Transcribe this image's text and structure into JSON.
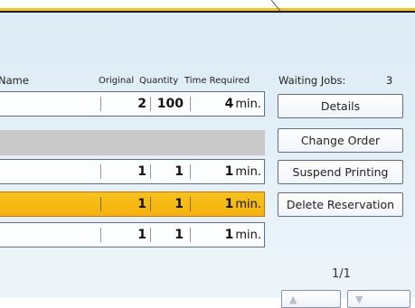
{
  "header": {
    "name": "Name",
    "original": "Original",
    "quantity": "Quantity",
    "time_required": "Time Required",
    "waiting_jobs_label": "Waiting Jobs:",
    "waiting_jobs_count": "3"
  },
  "jobs": [
    {
      "original": "2",
      "quantity": "100",
      "time": "4",
      "unit": "min.",
      "state": "normal"
    },
    {
      "original": "",
      "quantity": "",
      "time": "",
      "unit": "",
      "state": "empty"
    },
    {
      "original": "1",
      "quantity": "1",
      "time": "1",
      "unit": "min.",
      "state": "normal"
    },
    {
      "original": "1",
      "quantity": "1",
      "time": "1",
      "unit": "min.",
      "state": "selected"
    },
    {
      "original": "1",
      "quantity": "1",
      "time": "1",
      "unit": "min.",
      "state": "normal"
    }
  ],
  "buttons": {
    "details": "Details",
    "change_order": "Change Order",
    "suspend_printing": "Suspend Printing",
    "delete_reservation": "Delete Reservation"
  },
  "pager": {
    "page": "1/1"
  },
  "colors": {
    "panel": "#dcebf5",
    "selected_row": "#f4c31b",
    "border": "#5b6f86",
    "empty_row": "#c9c9c9"
  },
  "icons": [
    "previous-icon",
    "next-icon"
  ]
}
